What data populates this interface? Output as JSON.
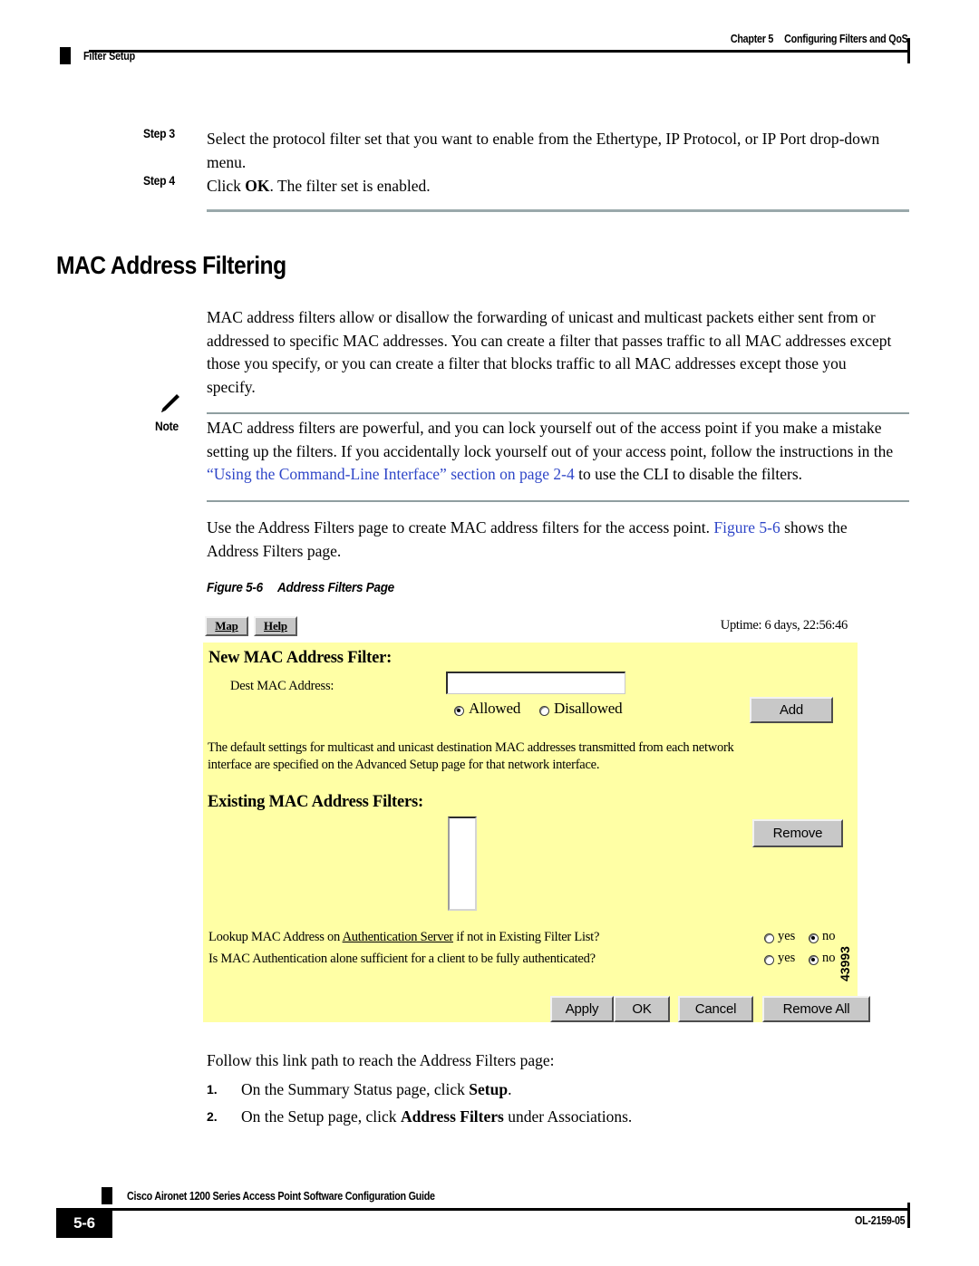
{
  "header": {
    "chapter": "Chapter 5",
    "chapter_title": "Configuring Filters and QoS",
    "running_head": "Filter Setup"
  },
  "steps": [
    {
      "label": "Step 3",
      "text": "Select the protocol filter set that you want to enable from the Ethertype, IP Protocol, or IP Port drop-down menu."
    },
    {
      "label": "Step 4",
      "text_pre": "Click ",
      "text_bold": "OK",
      "text_post": ". The filter set is enabled."
    }
  ],
  "section": {
    "title": "MAC Address Filtering",
    "intro": "MAC address filters allow or disallow the forwarding of unicast and multicast packets either sent from or addressed to specific MAC addresses. You can create a filter that passes traffic to all MAC addresses except those you specify, or you can create a filter that blocks traffic to all MAC addresses except those you specify."
  },
  "note": {
    "label": "Note",
    "text_pre": "MAC address filters are powerful, and you can lock yourself out of the access point if you make a mistake setting up the filters. If you accidentally lock yourself out of your access point, follow the instructions in the ",
    "link": "“Using the Command-Line Interface” section on page 2-4",
    "text_post": " to use the CLI to disable the filters."
  },
  "figure_intro": {
    "text_pre": "Use the Address Filters page to create MAC address filters for the access point. ",
    "link": "Figure 5-6",
    "text_post": " shows the Address Filters page."
  },
  "figure_caption": {
    "number": "Figure 5-6",
    "title": "Address Filters Page"
  },
  "figure": {
    "toolbar": {
      "map_button": "Map",
      "help_button": "Help",
      "uptime": "Uptime: 6 days, 22:56:46"
    },
    "new_filter": {
      "heading": "New MAC Address Filter:",
      "dest_label": "Dest MAC Address:",
      "dest_value": "",
      "radio_allowed": "Allowed",
      "radio_disallowed": "Disallowed",
      "radio_selected": "Allowed",
      "add_button": "Add"
    },
    "default_note_line1": "The default settings for multicast and unicast destination MAC addresses transmitted from each network",
    "default_note_line2": "interface are specified on the Advanced Setup page for that network interface.",
    "existing": {
      "heading": "Existing MAC Address Filters:",
      "list_items": [],
      "remove_button": "Remove"
    },
    "questions": [
      {
        "text_pre": "Lookup MAC Address on ",
        "text_link": "Authentication Server",
        "text_post": " if not in Existing Filter List?",
        "yes_label": "yes",
        "no_label": "no",
        "selected": "no"
      },
      {
        "text_pre": "Is MAC Authentication alone sufficient for a client to be fully authenticated?",
        "text_link": "",
        "text_post": "",
        "yes_label": "yes",
        "no_label": "no",
        "selected": "no"
      }
    ],
    "buttons": [
      "Apply",
      "OK",
      "Cancel",
      "Remove All"
    ],
    "art_number": "43993",
    "panel_color": "#ffffa5"
  },
  "link_path": {
    "intro": "Follow this link path to reach the Address Filters page:",
    "items": [
      {
        "n": "1.",
        "pre": "On the Summary Status page, click ",
        "bold": "Setup",
        "post": "."
      },
      {
        "n": "2.",
        "pre": "On the Setup page, click ",
        "bold": "Address Filters",
        "post": " under Associations."
      }
    ]
  },
  "footer": {
    "guide_title": "Cisco Aironet 1200 Series Access Point Software Configuration Guide",
    "page_number": "5-6",
    "doc_number": "OL-2159-05"
  }
}
